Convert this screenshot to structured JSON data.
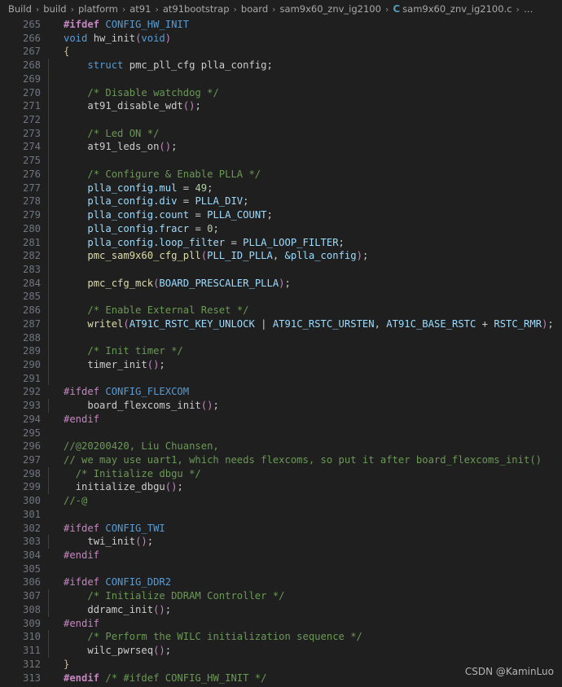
{
  "breadcrumb": {
    "items": [
      {
        "label": "Build",
        "icon": null
      },
      {
        "label": "build",
        "icon": null
      },
      {
        "label": "platform",
        "icon": null
      },
      {
        "label": "at91",
        "icon": null
      },
      {
        "label": "at91bootstrap",
        "icon": null
      },
      {
        "label": "board",
        "icon": null
      },
      {
        "label": "sam9x60_znv_ig2100",
        "icon": null
      },
      {
        "label": "sam9x60_znv_ig2100.c",
        "icon": "c-file-icon",
        "icon_label": "C"
      },
      {
        "label": "…",
        "icon": null
      }
    ],
    "separator": "›"
  },
  "editor": {
    "language": "c",
    "first_line_number": 265,
    "last_line_number": 313,
    "colors": {
      "background": "#1f1f1f",
      "foreground": "#cccccc",
      "line_number": "#6e7681",
      "comment": "#6a9955",
      "preprocessor": "#c586c0",
      "keyword": "#569cd6",
      "function": "#dcdcaa",
      "variable": "#9cdcfe",
      "number": "#b5cea8",
      "brace": "#d7ba7d",
      "indent_guide": "#404040"
    },
    "lines": [
      {
        "n": 265,
        "guides": [],
        "tokens": [
          {
            "t": "#ifdef",
            "c": "t-pre t-bold"
          },
          {
            "t": " ",
            "c": "t-plain"
          },
          {
            "t": "CONFIG_HW_INIT",
            "c": "t-macro"
          }
        ]
      },
      {
        "n": 266,
        "guides": [],
        "tokens": [
          {
            "t": "void",
            "c": "t-kw"
          },
          {
            "t": " ",
            "c": "t-plain"
          },
          {
            "t": "hw_init",
            "c": "t-plain"
          },
          {
            "t": "(",
            "c": "t-paren"
          },
          {
            "t": "void",
            "c": "t-kw"
          },
          {
            "t": ")",
            "c": "t-paren"
          }
        ]
      },
      {
        "n": 267,
        "guides": [],
        "tokens": [
          {
            "t": "{",
            "c": "t-brace"
          }
        ]
      },
      {
        "n": 268,
        "guides": [
          1
        ],
        "tokens": [
          {
            "t": "    ",
            "c": "t-plain"
          },
          {
            "t": "struct",
            "c": "t-kw"
          },
          {
            "t": " pmc_pll_cfg plla_config;",
            "c": "t-plain"
          }
        ]
      },
      {
        "n": 269,
        "guides": [
          1
        ],
        "tokens": []
      },
      {
        "n": 270,
        "guides": [
          1
        ],
        "tokens": [
          {
            "t": "    ",
            "c": "t-plain"
          },
          {
            "t": "/* Disable watchdog */",
            "c": "t-comment"
          }
        ]
      },
      {
        "n": 271,
        "guides": [
          1
        ],
        "tokens": [
          {
            "t": "    ",
            "c": "t-plain"
          },
          {
            "t": "at91_disable_wdt",
            "c": "t-plain"
          },
          {
            "t": "()",
            "c": "t-paren"
          },
          {
            "t": ";",
            "c": "t-plain"
          }
        ]
      },
      {
        "n": 272,
        "guides": [
          1
        ],
        "tokens": []
      },
      {
        "n": 273,
        "guides": [
          1
        ],
        "tokens": [
          {
            "t": "    ",
            "c": "t-plain"
          },
          {
            "t": "/* Led ON */",
            "c": "t-comment"
          }
        ]
      },
      {
        "n": 274,
        "guides": [
          1
        ],
        "tokens": [
          {
            "t": "    ",
            "c": "t-plain"
          },
          {
            "t": "at91_leds_on",
            "c": "t-plain"
          },
          {
            "t": "()",
            "c": "t-paren"
          },
          {
            "t": ";",
            "c": "t-plain"
          }
        ]
      },
      {
        "n": 275,
        "guides": [
          1
        ],
        "tokens": []
      },
      {
        "n": 276,
        "guides": [
          1
        ],
        "tokens": [
          {
            "t": "    ",
            "c": "t-plain"
          },
          {
            "t": "/* Configure & Enable PLLA */",
            "c": "t-comment"
          }
        ]
      },
      {
        "n": 277,
        "guides": [
          1
        ],
        "tokens": [
          {
            "t": "    ",
            "c": "t-plain"
          },
          {
            "t": "plla_config.mul",
            "c": "t-var"
          },
          {
            "t": " = ",
            "c": "t-op"
          },
          {
            "t": "49",
            "c": "t-num"
          },
          {
            "t": ";",
            "c": "t-plain"
          }
        ]
      },
      {
        "n": 278,
        "guides": [
          1
        ],
        "tokens": [
          {
            "t": "    ",
            "c": "t-plain"
          },
          {
            "t": "plla_config.div",
            "c": "t-var"
          },
          {
            "t": " = ",
            "c": "t-op"
          },
          {
            "t": "PLLA_DIV",
            "c": "t-const"
          },
          {
            "t": ";",
            "c": "t-plain"
          }
        ]
      },
      {
        "n": 279,
        "guides": [
          1
        ],
        "tokens": [
          {
            "t": "    ",
            "c": "t-plain"
          },
          {
            "t": "plla_config.count",
            "c": "t-var"
          },
          {
            "t": " = ",
            "c": "t-op"
          },
          {
            "t": "PLLA_COUNT",
            "c": "t-const"
          },
          {
            "t": ";",
            "c": "t-plain"
          }
        ]
      },
      {
        "n": 280,
        "guides": [
          1
        ],
        "tokens": [
          {
            "t": "    ",
            "c": "t-plain"
          },
          {
            "t": "plla_config.fracr",
            "c": "t-var"
          },
          {
            "t": " = ",
            "c": "t-op"
          },
          {
            "t": "0",
            "c": "t-num"
          },
          {
            "t": ";",
            "c": "t-plain"
          }
        ]
      },
      {
        "n": 281,
        "guides": [
          1
        ],
        "tokens": [
          {
            "t": "    ",
            "c": "t-plain"
          },
          {
            "t": "plla_config.loop_filter",
            "c": "t-var"
          },
          {
            "t": " = ",
            "c": "t-op"
          },
          {
            "t": "PLLA_LOOP_FILTER",
            "c": "t-const"
          },
          {
            "t": ";",
            "c": "t-plain"
          }
        ]
      },
      {
        "n": 282,
        "guides": [
          1
        ],
        "tokens": [
          {
            "t": "    ",
            "c": "t-plain"
          },
          {
            "t": "pmc_sam9x60_cfg_pll",
            "c": "t-fn"
          },
          {
            "t": "(",
            "c": "t-paren"
          },
          {
            "t": "PLL_ID_PLLA",
            "c": "t-const"
          },
          {
            "t": ", ",
            "c": "t-plain"
          },
          {
            "t": "&plla_config",
            "c": "t-const"
          },
          {
            "t": ")",
            "c": "t-paren"
          },
          {
            "t": ";",
            "c": "t-plain"
          }
        ]
      },
      {
        "n": 283,
        "guides": [
          1
        ],
        "tokens": []
      },
      {
        "n": 284,
        "guides": [
          1
        ],
        "tokens": [
          {
            "t": "    ",
            "c": "t-plain"
          },
          {
            "t": "pmc_cfg_mck",
            "c": "t-fn"
          },
          {
            "t": "(",
            "c": "t-paren"
          },
          {
            "t": "BOARD_PRESCALER_PLLA",
            "c": "t-const"
          },
          {
            "t": ")",
            "c": "t-paren"
          },
          {
            "t": ";",
            "c": "t-plain"
          }
        ]
      },
      {
        "n": 285,
        "guides": [
          1
        ],
        "tokens": []
      },
      {
        "n": 286,
        "guides": [
          1
        ],
        "tokens": [
          {
            "t": "    ",
            "c": "t-plain"
          },
          {
            "t": "/* Enable External Reset */",
            "c": "t-comment"
          }
        ]
      },
      {
        "n": 287,
        "guides": [
          1
        ],
        "tokens": [
          {
            "t": "    ",
            "c": "t-plain"
          },
          {
            "t": "writel",
            "c": "t-fn"
          },
          {
            "t": "(",
            "c": "t-paren"
          },
          {
            "t": "AT91C_RSTC_KEY_UNLOCK",
            "c": "t-const"
          },
          {
            "t": " | ",
            "c": "t-op"
          },
          {
            "t": "AT91C_RSTC_URSTEN",
            "c": "t-const"
          },
          {
            "t": ", ",
            "c": "t-plain"
          },
          {
            "t": "AT91C_BASE_RSTC",
            "c": "t-const"
          },
          {
            "t": " + ",
            "c": "t-op"
          },
          {
            "t": "RSTC_RMR",
            "c": "t-const"
          },
          {
            "t": ")",
            "c": "t-paren"
          },
          {
            "t": ";",
            "c": "t-plain"
          }
        ]
      },
      {
        "n": 288,
        "guides": [
          1
        ],
        "tokens": []
      },
      {
        "n": 289,
        "guides": [
          1
        ],
        "tokens": [
          {
            "t": "    ",
            "c": "t-plain"
          },
          {
            "t": "/* Init timer */",
            "c": "t-comment"
          }
        ]
      },
      {
        "n": 290,
        "guides": [
          1
        ],
        "tokens": [
          {
            "t": "    ",
            "c": "t-plain"
          },
          {
            "t": "timer_init",
            "c": "t-plain"
          },
          {
            "t": "()",
            "c": "t-paren"
          },
          {
            "t": ";",
            "c": "t-plain"
          }
        ]
      },
      {
        "n": 291,
        "guides": [
          1
        ],
        "tokens": []
      },
      {
        "n": 292,
        "guides": [],
        "tokens": [
          {
            "t": "#ifdef",
            "c": "t-pre"
          },
          {
            "t": " ",
            "c": "t-plain"
          },
          {
            "t": "CONFIG_FLEXCOM",
            "c": "t-macro"
          }
        ]
      },
      {
        "n": 293,
        "guides": [
          1
        ],
        "tokens": [
          {
            "t": "    ",
            "c": "t-plain"
          },
          {
            "t": "board_flexcoms_init",
            "c": "t-plain"
          },
          {
            "t": "()",
            "c": "t-paren"
          },
          {
            "t": ";",
            "c": "t-plain"
          }
        ]
      },
      {
        "n": 294,
        "guides": [],
        "tokens": [
          {
            "t": "#endif",
            "c": "t-pre"
          }
        ]
      },
      {
        "n": 295,
        "guides": [],
        "tokens": []
      },
      {
        "n": 296,
        "guides": [],
        "tokens": [
          {
            "t": "//@20200420, Liu Chuansen,",
            "c": "t-comment"
          }
        ]
      },
      {
        "n": 297,
        "guides": [],
        "tokens": [
          {
            "t": "// we may use uart1, which needs flexcoms, so put it after board_flexcoms_init()",
            "c": "t-comment"
          }
        ]
      },
      {
        "n": 298,
        "guides": [
          1
        ],
        "tokens": [
          {
            "t": "  ",
            "c": "t-plain"
          },
          {
            "t": "/* Initialize dbgu */",
            "c": "t-comment"
          }
        ]
      },
      {
        "n": 299,
        "guides": [
          1
        ],
        "tokens": [
          {
            "t": "  ",
            "c": "t-plain"
          },
          {
            "t": "initialize_dbgu",
            "c": "t-plain"
          },
          {
            "t": "()",
            "c": "t-paren"
          },
          {
            "t": ";",
            "c": "t-plain"
          }
        ]
      },
      {
        "n": 300,
        "guides": [],
        "tokens": [
          {
            "t": "//-@",
            "c": "t-comment"
          }
        ]
      },
      {
        "n": 301,
        "guides": [],
        "tokens": []
      },
      {
        "n": 302,
        "guides": [],
        "tokens": [
          {
            "t": "#ifdef",
            "c": "t-pre"
          },
          {
            "t": " ",
            "c": "t-plain"
          },
          {
            "t": "CONFIG_TWI",
            "c": "t-macro"
          }
        ]
      },
      {
        "n": 303,
        "guides": [
          1
        ],
        "tokens": [
          {
            "t": "    ",
            "c": "t-plain"
          },
          {
            "t": "twi_init",
            "c": "t-plain"
          },
          {
            "t": "()",
            "c": "t-paren"
          },
          {
            "t": ";",
            "c": "t-plain"
          }
        ]
      },
      {
        "n": 304,
        "guides": [],
        "tokens": [
          {
            "t": "#endif",
            "c": "t-pre"
          }
        ]
      },
      {
        "n": 305,
        "guides": [],
        "tokens": []
      },
      {
        "n": 306,
        "guides": [],
        "tokens": [
          {
            "t": "#ifdef",
            "c": "t-pre"
          },
          {
            "t": " ",
            "c": "t-plain"
          },
          {
            "t": "CONFIG_DDR2",
            "c": "t-macro"
          }
        ]
      },
      {
        "n": 307,
        "guides": [
          1
        ],
        "tokens": [
          {
            "t": "    ",
            "c": "t-plain"
          },
          {
            "t": "/* Initialize DDRAM Controller */",
            "c": "t-comment"
          }
        ]
      },
      {
        "n": 308,
        "guides": [
          1
        ],
        "tokens": [
          {
            "t": "    ",
            "c": "t-plain"
          },
          {
            "t": "ddramc_init",
            "c": "t-plain"
          },
          {
            "t": "()",
            "c": "t-paren"
          },
          {
            "t": ";",
            "c": "t-plain"
          }
        ]
      },
      {
        "n": 309,
        "guides": [],
        "tokens": [
          {
            "t": "#endif",
            "c": "t-pre"
          }
        ]
      },
      {
        "n": 310,
        "guides": [
          1
        ],
        "tokens": [
          {
            "t": "    ",
            "c": "t-plain"
          },
          {
            "t": "/* Perform the WILC initialization sequence */",
            "c": "t-comment"
          }
        ]
      },
      {
        "n": 311,
        "guides": [
          1
        ],
        "tokens": [
          {
            "t": "    ",
            "c": "t-plain"
          },
          {
            "t": "wilc_pwrseq",
            "c": "t-plain"
          },
          {
            "t": "()",
            "c": "t-paren"
          },
          {
            "t": ";",
            "c": "t-plain"
          }
        ]
      },
      {
        "n": 312,
        "guides": [],
        "tokens": [
          {
            "t": "}",
            "c": "t-brace"
          }
        ]
      },
      {
        "n": 313,
        "guides": [],
        "tokens": [
          {
            "t": "#endif",
            "c": "t-pre t-bold"
          },
          {
            "t": " ",
            "c": "t-plain"
          },
          {
            "t": "/* #ifdef CONFIG_HW_INIT */",
            "c": "t-comment"
          }
        ]
      }
    ]
  },
  "watermark": {
    "text": "CSDN @KaminLuo"
  }
}
